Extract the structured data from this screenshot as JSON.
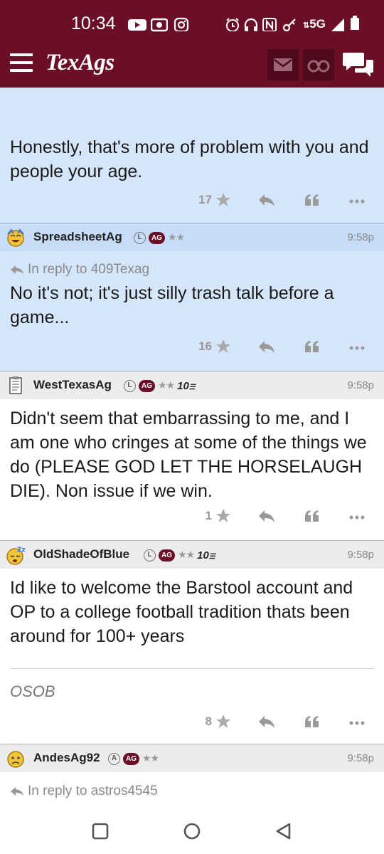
{
  "status_bar": {
    "time": "10:34",
    "network": "5G"
  },
  "top_nav": {
    "logo": "TexAgs",
    "icons": [
      "hamburger-icon",
      "mail-icon",
      "binoculars-icon",
      "chat-bubbles-icon"
    ]
  },
  "posts": [
    {
      "body": "Honestly, that's more of problem with you and people your age.",
      "count": "17"
    },
    {
      "user": "SpreadsheetAg",
      "badge_l": "L",
      "badge_ag": "AG",
      "stars": "★★",
      "time": "9:58p",
      "reply_to": "In reply to 409Texag",
      "body": "No it's not; it's just silly trash talk before a game...",
      "count": "16"
    },
    {
      "user": "WestTexasAg",
      "badge_l": "L",
      "badge_ag": "AG",
      "stars": "★★",
      "badge_10": "10",
      "time": "9:58p",
      "body": "Didn't seem that embarrassing to me, and I am one who cringes at some of the things we do (PLEASE GOD LET THE HORSELAUGH DIE). Non issue if we win.",
      "count": "1"
    },
    {
      "user": "OldShadeOfBlue",
      "badge_l": "L",
      "badge_ag": "AG",
      "stars": "★★",
      "badge_10": "10",
      "time": "9:58p",
      "body": "Id like to welcome the Barstool account and OP to a college football tradition thats been around for 100+ years",
      "signature": "OSOB",
      "count": "8"
    },
    {
      "user": "AndesAg92",
      "badge_l": "A",
      "badge_ag": "AG",
      "stars": "★★",
      "time": "9:58p",
      "reply_to": "In reply to astros4545"
    }
  ],
  "colors": {
    "maroon": "#6b0f26",
    "highlight": "#d5e6fa"
  }
}
